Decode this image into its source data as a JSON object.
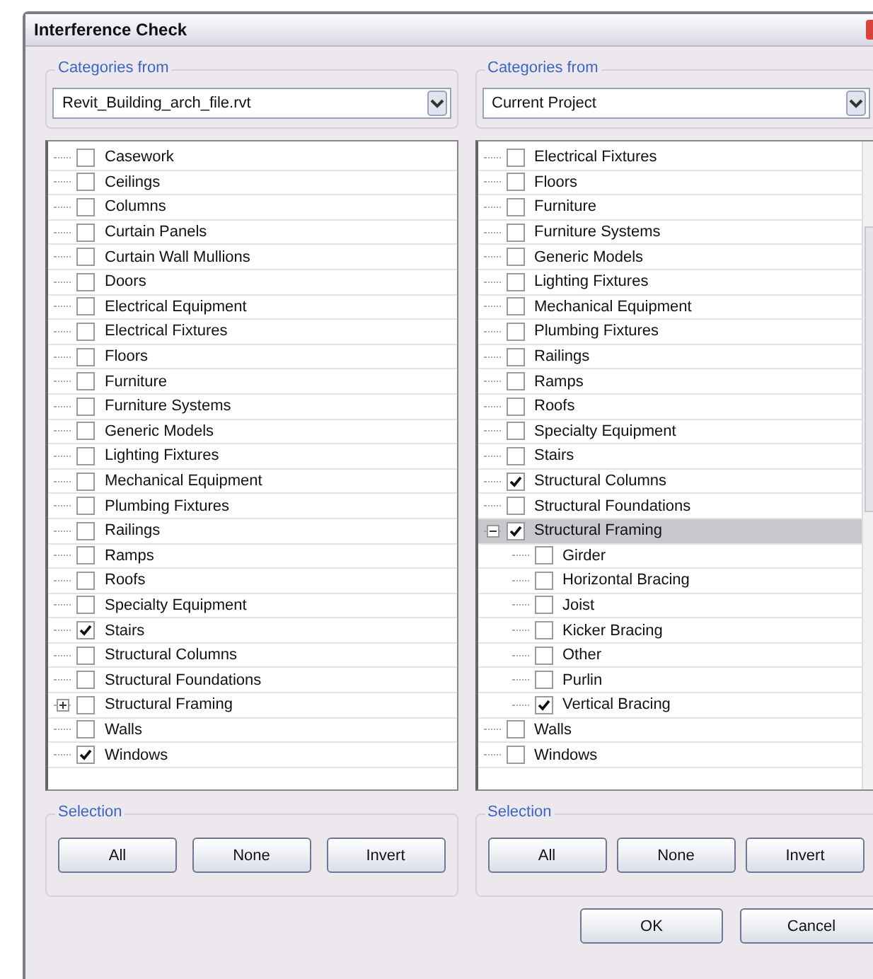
{
  "window": {
    "title": "Interference Check"
  },
  "panels": [
    {
      "source_label": "Categories from",
      "source": "Revit_Building_arch_file.rvt",
      "scrollable": false,
      "tree": [
        {
          "label": "Casework",
          "checked": false,
          "selected": false
        },
        {
          "label": "Ceilings",
          "checked": false,
          "selected": false
        },
        {
          "label": "Columns",
          "checked": false,
          "selected": false
        },
        {
          "label": "Curtain Panels",
          "checked": false,
          "selected": false
        },
        {
          "label": "Curtain Wall Mullions",
          "checked": false,
          "selected": false
        },
        {
          "label": "Doors",
          "checked": false,
          "selected": false
        },
        {
          "label": "Electrical Equipment",
          "checked": false,
          "selected": false
        },
        {
          "label": "Electrical Fixtures",
          "checked": false,
          "selected": false
        },
        {
          "label": "Floors",
          "checked": false,
          "selected": false
        },
        {
          "label": "Furniture",
          "checked": false,
          "selected": false
        },
        {
          "label": "Furniture Systems",
          "checked": false,
          "selected": false
        },
        {
          "label": "Generic Models",
          "checked": false,
          "selected": false
        },
        {
          "label": "Lighting Fixtures",
          "checked": false,
          "selected": false
        },
        {
          "label": "Mechanical Equipment",
          "checked": false,
          "selected": false
        },
        {
          "label": "Plumbing Fixtures",
          "checked": false,
          "selected": false
        },
        {
          "label": "Railings",
          "checked": false,
          "selected": false
        },
        {
          "label": "Ramps",
          "checked": false,
          "selected": false
        },
        {
          "label": "Roofs",
          "checked": false,
          "selected": false
        },
        {
          "label": "Specialty Equipment",
          "checked": false,
          "selected": false
        },
        {
          "label": "Stairs",
          "checked": true,
          "selected": false
        },
        {
          "label": "Structural Columns",
          "checked": false,
          "selected": false
        },
        {
          "label": "Structural Foundations",
          "checked": false,
          "selected": false
        },
        {
          "label": "Structural Framing",
          "checked": false,
          "selected": false,
          "expanded": false
        },
        {
          "label": "Walls",
          "checked": false,
          "selected": false
        },
        {
          "label": "Windows",
          "checked": true,
          "selected": false
        }
      ],
      "selection_label": "Selection",
      "buttons": [
        "All",
        "None",
        "Invert"
      ]
    },
    {
      "source_label": "Categories from",
      "source": "Current Project",
      "scrollable": true,
      "tree": [
        {
          "label": "Electrical Fixtures",
          "checked": false,
          "selected": false
        },
        {
          "label": "Floors",
          "checked": false,
          "selected": false
        },
        {
          "label": "Furniture",
          "checked": false,
          "selected": false
        },
        {
          "label": "Furniture Systems",
          "checked": false,
          "selected": false
        },
        {
          "label": "Generic Models",
          "checked": false,
          "selected": false
        },
        {
          "label": "Lighting Fixtures",
          "checked": false,
          "selected": false
        },
        {
          "label": "Mechanical Equipment",
          "checked": false,
          "selected": false
        },
        {
          "label": "Plumbing Fixtures",
          "checked": false,
          "selected": false
        },
        {
          "label": "Railings",
          "checked": false,
          "selected": false
        },
        {
          "label": "Ramps",
          "checked": false,
          "selected": false
        },
        {
          "label": "Roofs",
          "checked": false,
          "selected": false
        },
        {
          "label": "Specialty Equipment",
          "checked": false,
          "selected": false
        },
        {
          "label": "Stairs",
          "checked": false,
          "selected": false
        },
        {
          "label": "Structural Columns",
          "checked": true,
          "selected": false
        },
        {
          "label": "Structural Foundations",
          "checked": false,
          "selected": false
        },
        {
          "label": "Structural Framing",
          "checked": true,
          "selected": true,
          "expanded": true,
          "children": [
            {
              "label": "Girder",
              "checked": false,
              "selected": false
            },
            {
              "label": "Horizontal Bracing",
              "checked": false,
              "selected": false
            },
            {
              "label": "Joist",
              "checked": false,
              "selected": false
            },
            {
              "label": "Kicker Bracing",
              "checked": false,
              "selected": false
            },
            {
              "label": "Other",
              "checked": false,
              "selected": false
            },
            {
              "label": "Purlin",
              "checked": false,
              "selected": false
            },
            {
              "label": "Vertical Bracing",
              "checked": true,
              "selected": false
            }
          ]
        },
        {
          "label": "Walls",
          "checked": false,
          "selected": false
        },
        {
          "label": "Windows",
          "checked": false,
          "selected": false
        }
      ],
      "selection_label": "Selection",
      "buttons": [
        "All",
        "None",
        "Invert"
      ]
    }
  ],
  "buttons": [
    "OK",
    "Cancel"
  ]
}
